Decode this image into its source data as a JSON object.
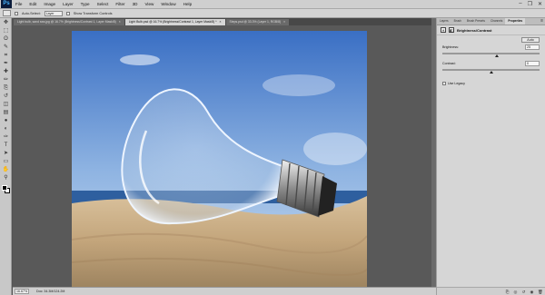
{
  "app": {
    "logo": "Ps"
  },
  "menu": {
    "items": [
      "File",
      "Edit",
      "Image",
      "Layer",
      "Type",
      "Select",
      "Filter",
      "3D",
      "View",
      "Window",
      "Help"
    ]
  },
  "window_controls": {
    "minimize": "–",
    "restore": "❐",
    "close": "✕"
  },
  "options_bar": {
    "auto_select_label": "Auto-Select:",
    "auto_select_value": "Layer",
    "transform_controls_label": "Show Transform Controls"
  },
  "doc_tabs": [
    {
      "label": "Light bulb, sand sea.jpg @ 16.7% (Brightness/Contrast 1, Layer Mask/8)",
      "active": false
    },
    {
      "label": "Light Bulb.psd @ 16.7% (Brightness/Contrast 1, Layer Mask/8) *",
      "active": true
    },
    {
      "label": "Steps.psd @ 33.3% (Layer 1, RGB/8)",
      "active": false
    }
  ],
  "toolbar": {
    "tools": [
      "move-tool",
      "marquee-tool",
      "lasso-tool",
      "quick-select-tool",
      "crop-tool",
      "eyedropper-tool",
      "healing-tool",
      "brush-tool",
      "clone-stamp-tool",
      "history-brush-tool",
      "eraser-tool",
      "gradient-tool",
      "blur-tool",
      "dodge-tool",
      "pen-tool",
      "type-tool",
      "path-select-tool",
      "shape-tool",
      "hand-tool",
      "zoom-tool"
    ],
    "glyphs": [
      "✥",
      "⬚",
      "ʘ",
      "✎",
      "⌗",
      "✒",
      "✚",
      "✏",
      "⎘",
      "↺",
      "◫",
      "▤",
      "●",
      "◐",
      "✑",
      "T",
      "➤",
      "▭",
      "✋",
      "⚲"
    ],
    "foreground_color": "#000000",
    "background_color": "#ffffff"
  },
  "status_bar": {
    "zoom": "16.67%",
    "doc_info": "Doc: 34.3M/124.2M"
  },
  "panel": {
    "tabs": [
      {
        "label": "Layers",
        "active": false
      },
      {
        "label": "Brush",
        "active": false
      },
      {
        "label": "Brush Presets",
        "active": false
      },
      {
        "label": "Channels",
        "active": false
      },
      {
        "label": "Properties",
        "active": true
      }
    ],
    "menu_glyph": "≡",
    "title": "Brightness/Contrast",
    "auto_button": "Auto",
    "brightness": {
      "label": "Brightness:",
      "value": "25",
      "fraction": 0.56
    },
    "contrast": {
      "label": "Contrast:",
      "value": "0",
      "fraction": 0.5
    },
    "use_legacy_label": "Use Legacy",
    "footer_icons": [
      "clip-icon",
      "visibility-icon",
      "reset-icon",
      "eye-icon",
      "trash-icon"
    ],
    "footer_glyphs": [
      "⎘",
      "◎",
      "↺",
      "◉",
      "🗑"
    ]
  },
  "colors": {
    "sky_top": "#3f74c7",
    "sky_bottom": "#bcd4ee",
    "sea": "#2f62a3",
    "sand": "#c9ad86"
  }
}
